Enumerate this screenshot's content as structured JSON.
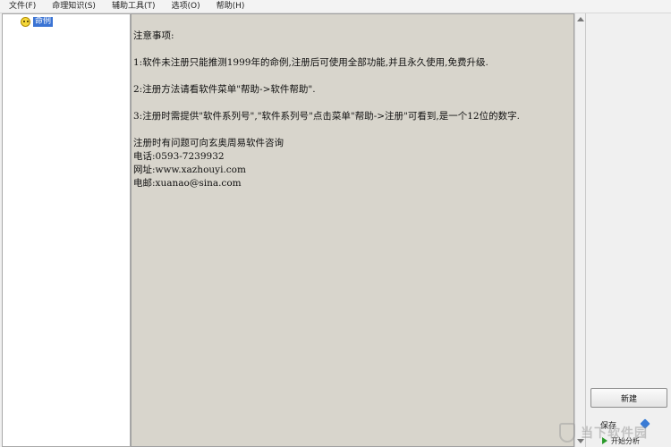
{
  "menu": {
    "items": [
      "文件(F)",
      "命理知识(S)",
      "辅助工具(T)",
      "选项(O)",
      "帮助(H)"
    ]
  },
  "tree": {
    "node_label": "命例",
    "icon": "smiley-icon"
  },
  "content": {
    "lines": [
      "注意事项:",
      "",
      "1:软件未注册只能推测1999年的命例,注册后可使用全部功能,并且永久使用,免费升级.",
      "",
      "2:注册方法请看软件菜单\"帮助->软件帮助\".",
      "",
      "3:注册时需提供\"软件系列号\",\"软件系列号\"点击菜单\"帮助->注册\"可看到,是一个12位的数字.",
      "",
      "注册时有问题可向玄奥周易软件咨询",
      "电话:0593-7239932",
      "网址:www.xazhouyi.com",
      "电邮:xuanao@sina.com"
    ]
  },
  "right_panel": {
    "new_button": "新建",
    "save_label": "保存",
    "start_label": "开始分析"
  },
  "watermark": {
    "text": "当下软件园"
  }
}
